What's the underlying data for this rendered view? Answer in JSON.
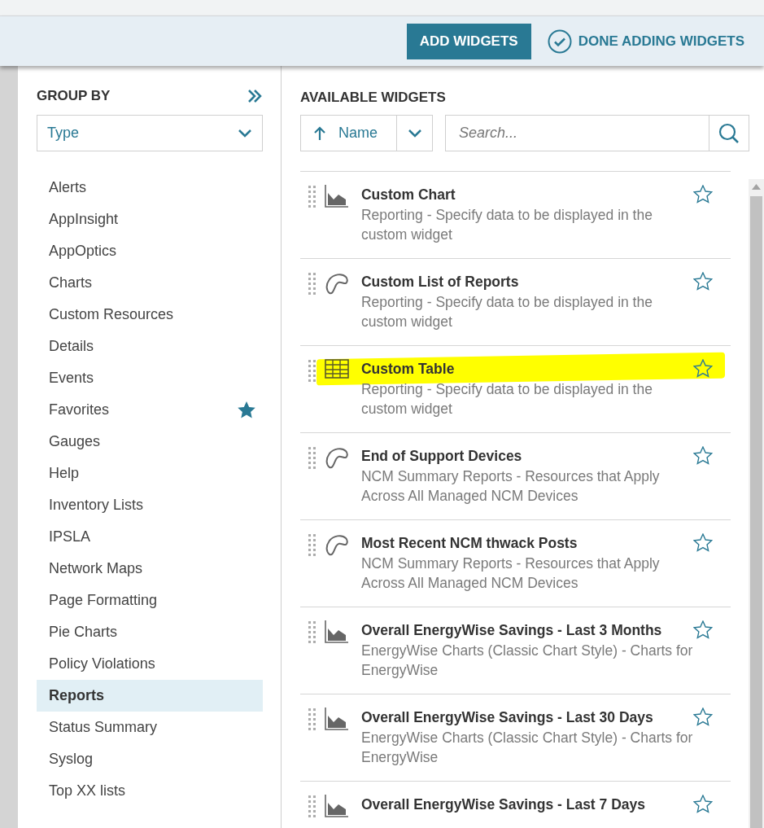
{
  "toolbar": {
    "add_button": "ADD WIDGETS",
    "done_button": "DONE ADDING WIDGETS"
  },
  "group_by": {
    "title": "GROUP BY",
    "select_value": "Type",
    "items": [
      {
        "label": "Alerts",
        "selected": false,
        "starred": false
      },
      {
        "label": "AppInsight",
        "selected": false,
        "starred": false
      },
      {
        "label": "AppOptics",
        "selected": false,
        "starred": false
      },
      {
        "label": "Charts",
        "selected": false,
        "starred": false
      },
      {
        "label": "Custom Resources",
        "selected": false,
        "starred": false
      },
      {
        "label": "Details",
        "selected": false,
        "starred": false
      },
      {
        "label": "Events",
        "selected": false,
        "starred": false
      },
      {
        "label": "Favorites",
        "selected": false,
        "starred": true
      },
      {
        "label": "Gauges",
        "selected": false,
        "starred": false
      },
      {
        "label": "Help",
        "selected": false,
        "starred": false
      },
      {
        "label": "Inventory Lists",
        "selected": false,
        "starred": false
      },
      {
        "label": "IPSLA",
        "selected": false,
        "starred": false
      },
      {
        "label": "Network Maps",
        "selected": false,
        "starred": false
      },
      {
        "label": "Page Formatting",
        "selected": false,
        "starred": false
      },
      {
        "label": "Pie Charts",
        "selected": false,
        "starred": false
      },
      {
        "label": "Policy Violations",
        "selected": false,
        "starred": false
      },
      {
        "label": "Reports",
        "selected": true,
        "starred": false
      },
      {
        "label": "Status Summary",
        "selected": false,
        "starred": false
      },
      {
        "label": "Syslog",
        "selected": false,
        "starred": false
      },
      {
        "label": "Top XX lists",
        "selected": false,
        "starred": false
      }
    ]
  },
  "widgets": {
    "title": "AVAILABLE WIDGETS",
    "sort_label": "Name",
    "search_placeholder": "Search...",
    "items": [
      {
        "kind": "chart",
        "title": "Custom Chart",
        "description": "Reporting - Specify data to be displayed in the custom widget",
        "starred": false,
        "highlighted": false
      },
      {
        "kind": "report",
        "title": "Custom List of Reports",
        "description": "Reporting - Specify data to be displayed in the custom widget",
        "starred": false,
        "highlighted": false
      },
      {
        "kind": "table",
        "title": "Custom Table",
        "description": "Reporting - Specify data to be displayed in the custom widget",
        "starred": false,
        "highlighted": true
      },
      {
        "kind": "report",
        "title": "End of Support Devices",
        "description": "NCM Summary Reports - Resources that Apply Across All Managed NCM Devices",
        "starred": false,
        "highlighted": false
      },
      {
        "kind": "report",
        "title": "Most Recent NCM thwack Posts",
        "description": "NCM Summary Reports - Resources that Apply Across All Managed NCM Devices",
        "starred": false,
        "highlighted": false
      },
      {
        "kind": "chart",
        "title": "Overall EnergyWise Savings - Last 3 Months",
        "description": "EnergyWise Charts (Classic Chart Style) - Charts for EnergyWise",
        "starred": false,
        "highlighted": false
      },
      {
        "kind": "chart",
        "title": "Overall EnergyWise Savings - Last 30 Days",
        "description": "EnergyWise Charts (Classic Chart Style) - Charts for EnergyWise",
        "starred": false,
        "highlighted": false
      },
      {
        "kind": "chart",
        "title": "Overall EnergyWise Savings - Last 7 Days",
        "starred": false,
        "highlighted": false
      }
    ]
  }
}
